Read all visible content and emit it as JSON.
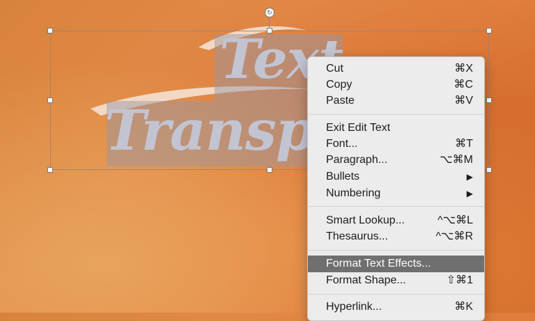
{
  "slide": {
    "line1": "Text",
    "line2": "Transparency",
    "rotate_icon": "rotate-icon"
  },
  "context_menu": {
    "items": [
      {
        "label": "Cut",
        "shortcut": "⌘X"
      },
      {
        "label": "Copy",
        "shortcut": "⌘C"
      },
      {
        "label": "Paste",
        "shortcut": "⌘V"
      },
      {
        "label": "Exit Edit Text",
        "shortcut": ""
      },
      {
        "label": "Font...",
        "shortcut": "⌘T"
      },
      {
        "label": "Paragraph...",
        "shortcut": "⌥⌘M"
      },
      {
        "label": "Bullets",
        "shortcut": "▶"
      },
      {
        "label": "Numbering",
        "shortcut": "▶"
      },
      {
        "label": "Smart Lookup...",
        "shortcut": "^⌥⌘L"
      },
      {
        "label": "Thesaurus...",
        "shortcut": "^⌥⌘R"
      },
      {
        "label": "Format Text Effects...",
        "shortcut": ""
      },
      {
        "label": "Format Shape...",
        "shortcut": "⇧⌘1"
      },
      {
        "label": "Hyperlink...",
        "shortcut": "⌘K"
      }
    ],
    "highlighted_item": "Format Text Effects..."
  },
  "colors": {
    "background": "#e38a48",
    "text_fill": "#c3c4d2",
    "menu_background": "#ececec",
    "menu_highlight": "#6f6f6f"
  }
}
